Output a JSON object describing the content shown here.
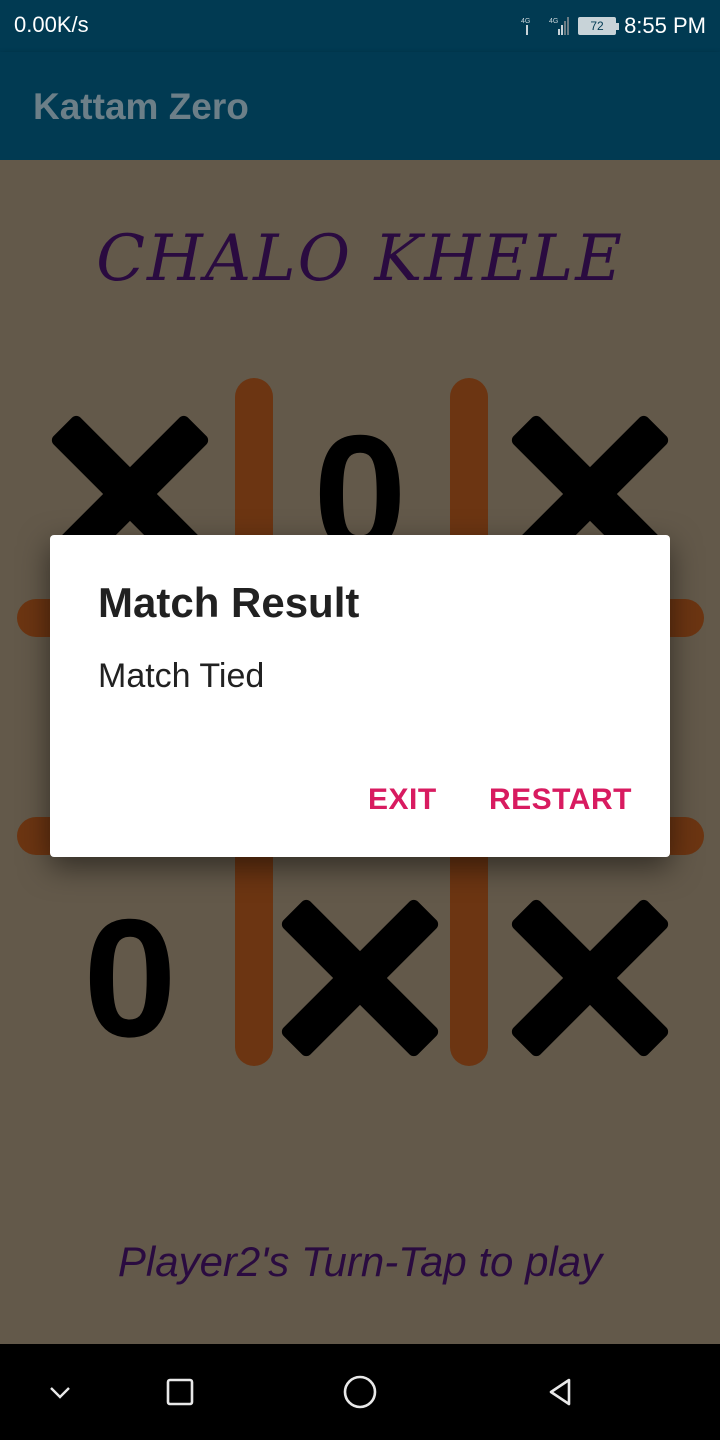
{
  "status_bar": {
    "speed": "0.00K/s",
    "network_1": "4G",
    "network_2": "4G",
    "battery": "72",
    "time": "8:55 PM"
  },
  "app_bar": {
    "title": "Kattam Zero"
  },
  "game": {
    "heading": "CHALO KHELE",
    "board": [
      [
        "X",
        "O",
        "X"
      ],
      [
        "",
        "",
        ""
      ],
      [
        "O",
        "X",
        "X"
      ]
    ],
    "turn_text": "Player2's Turn-Tap to play"
  },
  "dialog": {
    "title": "Match Result",
    "message": "Match Tied",
    "exit_label": "EXIT",
    "restart_label": "RESTART"
  },
  "nav_bar": {
    "icons": [
      "chevron-down-icon",
      "recent-apps-icon",
      "home-icon",
      "back-icon"
    ]
  },
  "colors": {
    "app_bar": "#013a52",
    "background": "#63594a",
    "board_lines": "#6c3512",
    "heading_text": "#2a0b40",
    "dialog_accent": "#d81b60"
  }
}
